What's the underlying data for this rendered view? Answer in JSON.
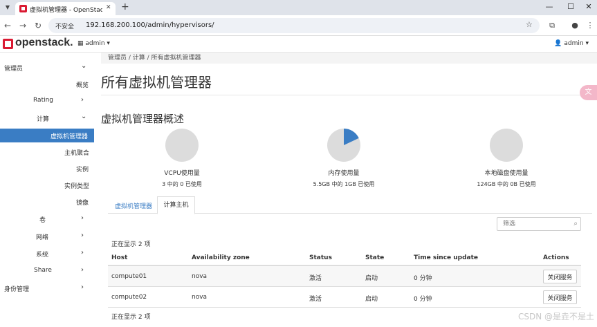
{
  "browser": {
    "tab_title": "虚拟机管理器 - OpenStack Da",
    "tab_close": "✕",
    "new_tab": "+",
    "insecure_label": "不安全",
    "url": "192.168.200.100/admin/hypervisors/"
  },
  "header": {
    "logo": "openstack.",
    "project": "admin ▾",
    "user": "admin ▾"
  },
  "sidebar": {
    "items": [
      {
        "label": "管理员"
      },
      {
        "label": "概览"
      },
      {
        "label": "Rating"
      },
      {
        "label": "计算"
      },
      {
        "label": "虚拟机管理器"
      },
      {
        "label": "主机聚合"
      },
      {
        "label": "实例"
      },
      {
        "label": "实例类型"
      },
      {
        "label": "镜像"
      },
      {
        "label": "卷"
      },
      {
        "label": "网络"
      },
      {
        "label": "系统"
      },
      {
        "label": "Share"
      },
      {
        "label": "身份管理"
      }
    ]
  },
  "breadcrumb": "管理员 /  计算 /  所有虚拟机管理器",
  "page_title": "所有虚拟机管理器",
  "section_title": "虚拟机管理器概述",
  "usage": [
    {
      "label": "VCPU使用量",
      "detail": "3 中的 0 已使用",
      "used_fraction": 0.0
    },
    {
      "label": "内存使用量",
      "detail": "5.5GB 中的 1GB 已使用",
      "used_fraction": 0.18
    },
    {
      "label": "本地磁盘使用量",
      "detail": "124GB 中的 0B 已使用",
      "used_fraction": 0.0
    }
  ],
  "colors": {
    "pie_used": "#3a7dc4",
    "pie_free": "#dcdcdc",
    "accent": "#3a7dc4"
  },
  "tabs": {
    "hypervisors": "虚拟机管理器",
    "compute_host": "计算主机"
  },
  "filter": {
    "placeholder": "筛选",
    "icon": "search-icon"
  },
  "table": {
    "count_top": "正在显示 2 项",
    "count_bottom": "正在显示 2 项",
    "headers": {
      "host": "Host",
      "zone": "Availability zone",
      "status": "Status",
      "state": "State",
      "time": "Time since update",
      "actions": "Actions"
    },
    "rows": [
      {
        "host": "compute01",
        "zone": "nova",
        "status": "激活",
        "state": "启动",
        "time": "0 分钟",
        "action": "关闭服务"
      },
      {
        "host": "compute02",
        "zone": "nova",
        "status": "激活",
        "state": "启动",
        "time": "0 分钟",
        "action": "关闭服务"
      }
    ]
  },
  "watermark": "CSDN @是垚不是土"
}
